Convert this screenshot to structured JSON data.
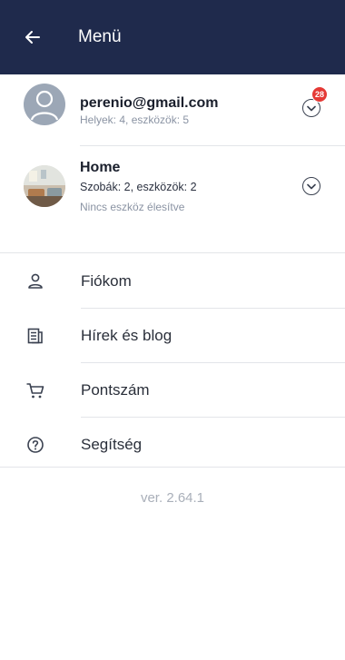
{
  "header": {
    "title": "Menü",
    "back_icon": "arrow-left-icon",
    "bg_color": "#1f2a4c"
  },
  "account": {
    "email": "perenio@gmail.com",
    "summary": "Helyek: 4, eszközök: 5",
    "notification_count": "28",
    "expand_icon": "chevron-down-circle-icon",
    "badge_color": "#e53935"
  },
  "location": {
    "name": "Home",
    "summary": "Szobák: 2, eszközök: 2",
    "status": "Nincs eszköz élesítve",
    "expand_icon": "chevron-down-circle-icon"
  },
  "menu": {
    "items": [
      {
        "label": "Fiókom",
        "icon": "user-icon"
      },
      {
        "label": "Hírek és blog",
        "icon": "news-icon"
      },
      {
        "label": "Pontszám",
        "icon": "cart-icon"
      },
      {
        "label": "Segítség",
        "icon": "help-icon"
      }
    ]
  },
  "version": "ver. 2.64.1"
}
